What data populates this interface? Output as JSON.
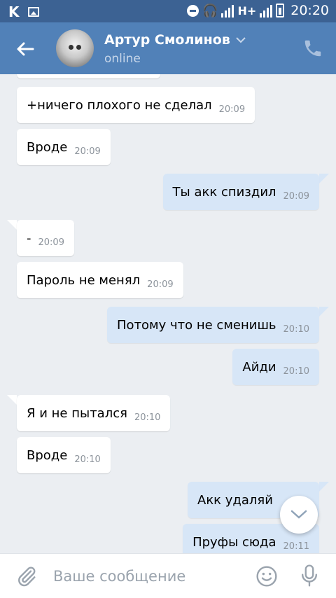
{
  "status_bar": {
    "time": "20:20",
    "network": "H+",
    "app_icon": "vk-logo-icon"
  },
  "header": {
    "contact_name": "Артур Смолинов",
    "status": "online",
    "back_icon": "arrow-left-icon",
    "call_icon": "phone-icon",
    "dropdown_icon": "chevron-down-icon"
  },
  "messages": [
    {
      "dir": "in",
      "text": "+ничего плохого не сделал",
      "time": "20:09"
    },
    {
      "dir": "in",
      "text": "Вроде",
      "time": "20:09"
    },
    {
      "dir": "out",
      "text": "Ты акк спиздил",
      "time": "20:09"
    },
    {
      "dir": "in",
      "text": "-",
      "time": "20:09"
    },
    {
      "dir": "in",
      "text": "Пароль не менял",
      "time": "20:09"
    },
    {
      "dir": "out",
      "text": "Потому что не сменишь",
      "time": "20:10"
    },
    {
      "dir": "out",
      "text": "Айди",
      "time": "20:10"
    },
    {
      "dir": "in",
      "text": "Я и не пытался",
      "time": "20:10"
    },
    {
      "dir": "in",
      "text": "Вроде",
      "time": "20:10"
    },
    {
      "dir": "out",
      "text": "Акк удаляй",
      "time": ""
    },
    {
      "dir": "out",
      "text": "Пруфы сюда",
      "time": "20:11"
    }
  ],
  "composer": {
    "placeholder": "Ваше сообщение",
    "attach_icon": "paperclip-icon",
    "emoji_icon": "smiley-icon",
    "mic_icon": "microphone-icon"
  },
  "colors": {
    "header": "#5181b8",
    "status_bar": "#3c6293",
    "outgoing_bubble": "#d7e6f7",
    "incoming_bubble": "#ffffff",
    "chat_bg": "#ebeef2"
  }
}
